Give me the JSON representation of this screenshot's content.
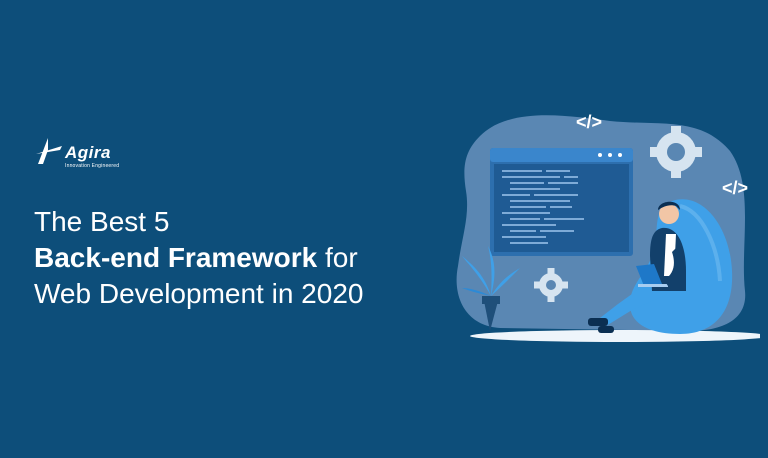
{
  "brand": {
    "name": "Agira",
    "tagline": "Innovation Engineered"
  },
  "headline": {
    "line1": "The Best 5",
    "line2_bold": "Back-end Framework",
    "line2_rest": " for",
    "line3": "Web Development in 2020"
  },
  "illustration": {
    "code_tag_top": "</>",
    "code_tag_right": "</>"
  },
  "colors": {
    "background": "#0d4e7a",
    "blob": "#5a87b3",
    "accent": "#3fa0e8",
    "text": "#ffffff"
  }
}
